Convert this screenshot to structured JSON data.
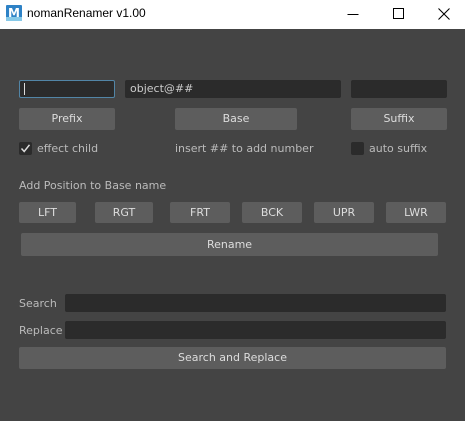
{
  "window": {
    "title": "nomanRenamer v1.00",
    "icon": "maya-app-icon",
    "icon_letter": "M",
    "controls": [
      "minimize-icon",
      "maximize-icon",
      "close-icon"
    ]
  },
  "prefix_field": {
    "value": ""
  },
  "base_field": {
    "value": "object@##"
  },
  "suffix_field": {
    "value": ""
  },
  "buttons": {
    "prefix": "Prefix",
    "base": "Base",
    "suffix": "Suffix",
    "rename": "Rename",
    "search_replace": "Search and Replace"
  },
  "options": {
    "effect_child": {
      "label": "effect child",
      "checked": true
    },
    "hint": "insert ## to add number",
    "auto_suffix": {
      "label": "auto suffix",
      "checked": false
    }
  },
  "position": {
    "heading": "Add Position to Base name",
    "buttons": [
      "LFT",
      "RGT",
      "FRT",
      "BCK",
      "UPR",
      "LWR"
    ]
  },
  "search": {
    "label": "Search",
    "value": ""
  },
  "replace": {
    "label": "Replace",
    "value": ""
  },
  "colors": {
    "background": "#444444",
    "field": "#2b2b2b",
    "button": "#5d5d5d",
    "focus_border": "#5285a6",
    "text": "#bbbbbb"
  }
}
